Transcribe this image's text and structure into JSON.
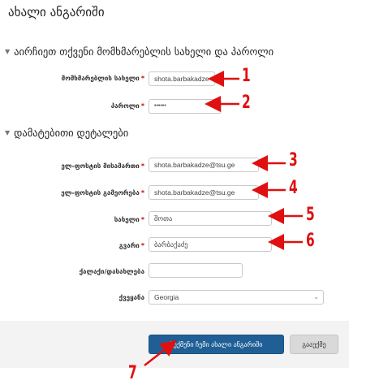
{
  "page": {
    "title": "ახალი ანგარიში"
  },
  "sections": {
    "credentials": {
      "title": "აირჩიეთ თქვენი მომხმარებლის სახელი და პაროლი"
    },
    "details": {
      "title": "დამატებითი დეტალები"
    }
  },
  "fields": {
    "username": {
      "label": "მომხმარებლის სახელი",
      "value": "shota.barbakadze",
      "required": true
    },
    "password": {
      "label": "პაროლი",
      "value": "••••••",
      "required": true
    },
    "email": {
      "label": "ელ-ფოსტის მისამართი",
      "value": "shota.barbakadze@tsu.ge",
      "required": true
    },
    "email_confirm": {
      "label": "ელ-ფოსტის გამეორება",
      "value": "shota.barbakadze@tsu.ge",
      "required": true
    },
    "firstname": {
      "label": "სახელი",
      "value": "შოთა",
      "required": true
    },
    "lastname": {
      "label": "გვარი",
      "value": "ბარბაქაძე",
      "required": true
    },
    "city": {
      "label": "ქალაქი/დასახლება",
      "value": ""
    },
    "country": {
      "label": "ქვეყანა",
      "value": "Georgia"
    }
  },
  "required_marker": "*",
  "buttons": {
    "submit": "შექმენი ჩემი ახალი ანგარიში",
    "cancel": "გააუქმე"
  },
  "callouts": [
    "1",
    "2",
    "3",
    "4",
    "5",
    "6",
    "7"
  ],
  "colors": {
    "primary": "#1f5f96",
    "required": "#cc0000",
    "annotation": "#e01010"
  }
}
